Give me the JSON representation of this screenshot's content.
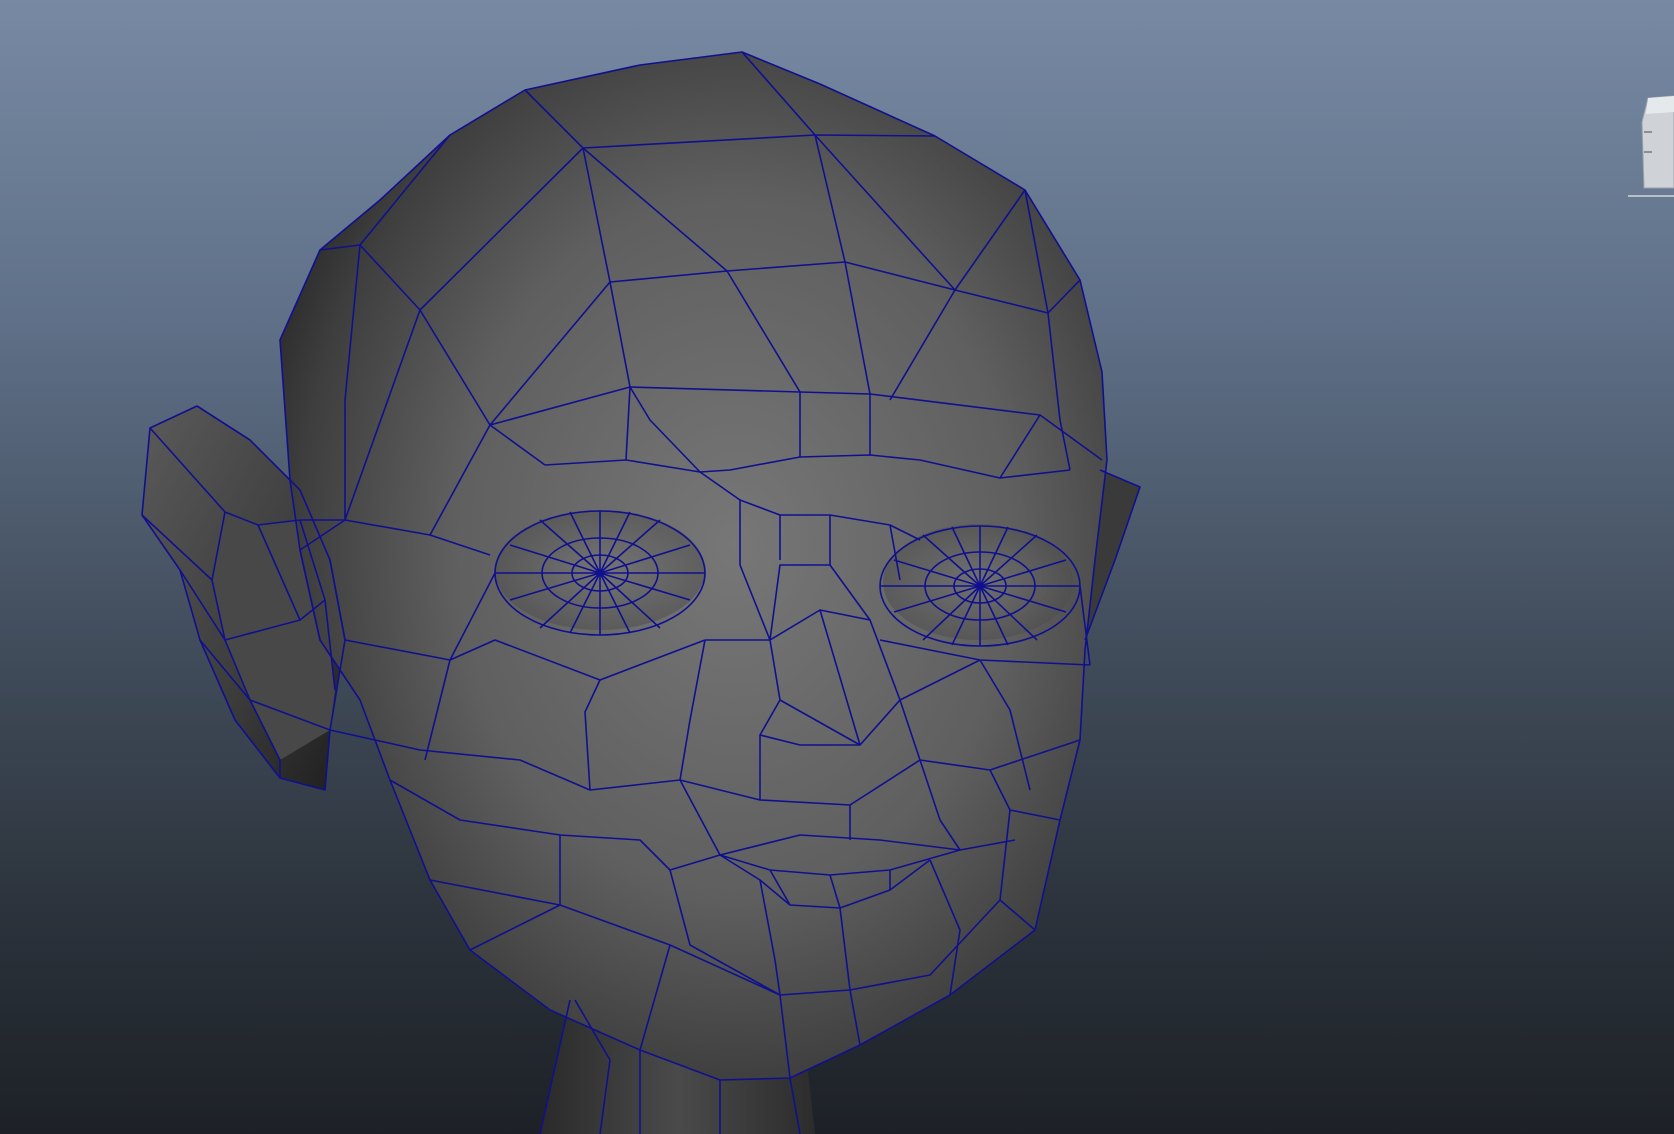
{
  "viewport": {
    "background_top": "#7889a3",
    "background_bottom": "#1d2127",
    "wireframe_color": "#0d0d8a",
    "surface_color": "#5a5a5a"
  },
  "scene": {
    "object": "head-mesh",
    "display_mode": "shaded-wireframe",
    "view_cube_icon": "view-cube-icon"
  }
}
